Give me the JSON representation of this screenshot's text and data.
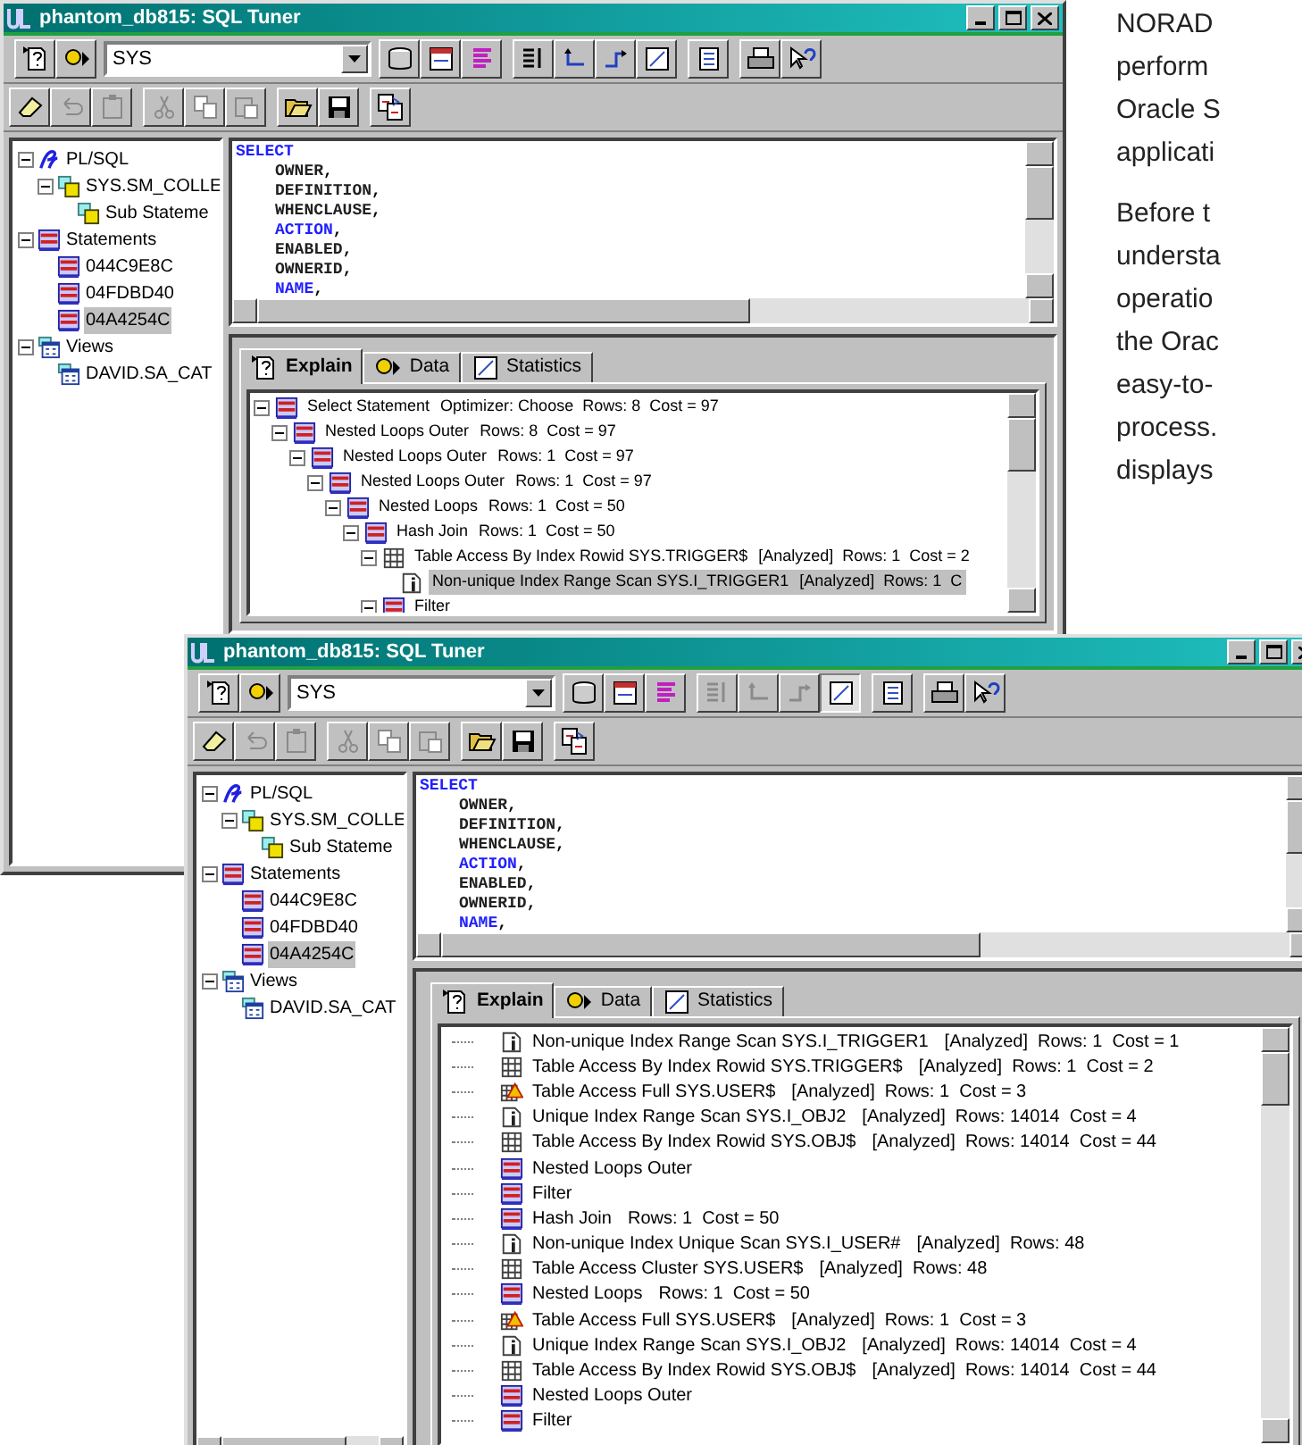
{
  "windows": [
    {
      "title": "phantom_db815: SQL Tuner",
      "schema": "SYS",
      "toolbar_top": [
        {
          "kind": "help-page",
          "disabled": false,
          "pressed": false
        },
        {
          "kind": "run",
          "disabled": false,
          "pressed": false
        },
        {
          "kind": "database",
          "disabled": false,
          "pressed": false
        },
        {
          "kind": "form",
          "disabled": false,
          "pressed": false
        },
        {
          "kind": "bars",
          "disabled": false,
          "pressed": false
        },
        {
          "kind": "split",
          "disabled": false,
          "pressed": false
        },
        {
          "kind": "step-in",
          "disabled": false,
          "pressed": false
        },
        {
          "kind": "step-out",
          "disabled": false,
          "pressed": false
        },
        {
          "kind": "chart",
          "disabled": false,
          "pressed": false
        },
        {
          "kind": "list",
          "disabled": false,
          "pressed": false
        },
        {
          "kind": "print",
          "disabled": false,
          "pressed": false
        },
        {
          "kind": "context-help",
          "disabled": false,
          "pressed": false
        }
      ],
      "toolbar_bottom": [
        {
          "kind": "eraser",
          "disabled": false,
          "pressed": false
        },
        {
          "kind": "undo",
          "disabled": true,
          "pressed": false
        },
        {
          "kind": "clipboard",
          "disabled": true,
          "pressed": false
        },
        {
          "kind": "cut",
          "disabled": true,
          "pressed": false
        },
        {
          "kind": "copy",
          "disabled": true,
          "pressed": false
        },
        {
          "kind": "paste",
          "disabled": true,
          "pressed": false
        },
        {
          "kind": "open",
          "disabled": false,
          "pressed": false
        },
        {
          "kind": "save",
          "disabled": false,
          "pressed": false
        },
        {
          "kind": "compare",
          "disabled": false,
          "pressed": false
        }
      ],
      "object_tree": [
        {
          "label": "PL/SQL",
          "kind": "plsql",
          "expanded": true,
          "selected": false,
          "children": [
            {
              "label": "SYS.SM_COLLE",
              "kind": "package",
              "expanded": true,
              "selected": false,
              "children": [
                {
                  "label": "Sub Stateme",
                  "kind": "package",
                  "selected": false
                }
              ]
            }
          ]
        },
        {
          "label": "Statements",
          "kind": "sql",
          "expanded": true,
          "selected": false,
          "children": [
            {
              "label": "044C9E8C",
              "kind": "sql",
              "selected": false
            },
            {
              "label": "04FDBD40",
              "kind": "sql",
              "selected": false
            },
            {
              "label": "04A4254C",
              "kind": "sql",
              "selected": true
            }
          ]
        },
        {
          "label": "Views",
          "kind": "view",
          "expanded": true,
          "selected": false,
          "children": [
            {
              "label": "DAVID.SA_CAT",
              "kind": "view",
              "selected": false
            }
          ]
        }
      ],
      "sql_lines": [
        {
          "text": "SELECT",
          "keyword": true
        },
        {
          "text": "OWNER",
          "keyword": false,
          "punct": ","
        },
        {
          "text": "DEFINITION",
          "keyword": false,
          "punct": ","
        },
        {
          "text": "WHENCLAUSE",
          "keyword": false,
          "punct": ","
        },
        {
          "text": "ACTION",
          "keyword": true,
          "punct": ","
        },
        {
          "text": "ENABLED",
          "keyword": false,
          "punct": ","
        },
        {
          "text": "OWNERID",
          "keyword": false,
          "punct": ","
        },
        {
          "text": "NAME",
          "keyword": true,
          "punct": ","
        }
      ],
      "tabs": [
        {
          "label": "Explain",
          "selected": true
        },
        {
          "label": "Data",
          "selected": false
        },
        {
          "label": "Statistics",
          "selected": false
        }
      ],
      "plan": [
        {
          "operation": "Select Statement",
          "details": "Optimizer: Choose  Rows: 8  Cost = 97",
          "kind": "sql",
          "expanded": true,
          "selected": false,
          "children": [
            {
              "operation": "Nested Loops Outer",
              "details": "Rows: 8  Cost = 97",
              "kind": "sql",
              "expanded": true,
              "selected": false,
              "children": [
                {
                  "operation": "Nested Loops Outer",
                  "details": "Rows: 1  Cost = 97",
                  "kind": "sql",
                  "expanded": true,
                  "selected": false,
                  "children": [
                    {
                      "operation": "Nested Loops Outer",
                      "details": "Rows: 1  Cost = 97",
                      "kind": "sql",
                      "expanded": true,
                      "selected": false,
                      "children": [
                        {
                          "operation": "Nested Loops",
                          "details": "Rows: 1  Cost = 50",
                          "kind": "sql",
                          "expanded": true,
                          "selected": false,
                          "children": [
                            {
                              "operation": "Hash Join",
                              "details": "Rows: 1  Cost = 50",
                              "kind": "sql",
                              "expanded": true,
                              "selected": false,
                              "children": [
                                {
                                  "operation": "Table Access By Index Rowid SYS.TRIGGER$",
                                  "details": "[Analyzed]  Rows: 1  Cost = 2",
                                  "kind": "table",
                                  "expanded": true,
                                  "selected": false,
                                  "children": [
                                    {
                                      "operation": "Non-unique Index Range Scan SYS.I_TRIGGER1",
                                      "details": "[Analyzed]  Rows: 1  C",
                                      "kind": "index",
                                      "selected": true
                                    }
                                  ]
                                },
                                {
                                  "operation": "Filter",
                                  "kind": "sql",
                                  "expanded": true,
                                  "selected": false
                                }
                              ]
                            }
                          ]
                        }
                      ]
                    }
                  ]
                }
              ]
            }
          ]
        }
      ]
    },
    {
      "title": "phantom_db815: SQL Tuner",
      "schema": "SYS",
      "toolbar_top": [
        {
          "kind": "help-page",
          "disabled": false,
          "pressed": false
        },
        {
          "kind": "run",
          "disabled": false,
          "pressed": false
        },
        {
          "kind": "database",
          "disabled": false,
          "pressed": false
        },
        {
          "kind": "form",
          "disabled": false,
          "pressed": false
        },
        {
          "kind": "bars",
          "disabled": false,
          "pressed": false
        },
        {
          "kind": "split",
          "disabled": true,
          "pressed": false
        },
        {
          "kind": "step-in",
          "disabled": true,
          "pressed": false
        },
        {
          "kind": "step-out",
          "disabled": true,
          "pressed": false
        },
        {
          "kind": "chart",
          "disabled": false,
          "pressed": true
        },
        {
          "kind": "list",
          "disabled": false,
          "pressed": false
        },
        {
          "kind": "print",
          "disabled": false,
          "pressed": false
        },
        {
          "kind": "context-help",
          "disabled": false,
          "pressed": false
        }
      ],
      "toolbar_bottom": [
        {
          "kind": "eraser",
          "disabled": false,
          "pressed": false
        },
        {
          "kind": "undo",
          "disabled": true,
          "pressed": false
        },
        {
          "kind": "clipboard",
          "disabled": true,
          "pressed": false
        },
        {
          "kind": "cut",
          "disabled": true,
          "pressed": false
        },
        {
          "kind": "copy",
          "disabled": true,
          "pressed": false
        },
        {
          "kind": "paste",
          "disabled": true,
          "pressed": false
        },
        {
          "kind": "open",
          "disabled": false,
          "pressed": false
        },
        {
          "kind": "save",
          "disabled": false,
          "pressed": false
        },
        {
          "kind": "compare",
          "disabled": false,
          "pressed": false
        }
      ],
      "object_tree": [
        {
          "label": "PL/SQL",
          "kind": "plsql",
          "expanded": true,
          "selected": false,
          "children": [
            {
              "label": "SYS.SM_COLLE",
              "kind": "package",
              "expanded": true,
              "selected": false,
              "children": [
                {
                  "label": "Sub Stateme",
                  "kind": "package",
                  "selected": false
                }
              ]
            }
          ]
        },
        {
          "label": "Statements",
          "kind": "sql",
          "expanded": true,
          "selected": false,
          "children": [
            {
              "label": "044C9E8C",
              "kind": "sql",
              "selected": false
            },
            {
              "label": "04FDBD40",
              "kind": "sql",
              "selected": false
            },
            {
              "label": "04A4254C",
              "kind": "sql",
              "selected": true
            }
          ]
        },
        {
          "label": "Views",
          "kind": "view",
          "expanded": true,
          "selected": false,
          "children": [
            {
              "label": "DAVID.SA_CAT",
              "kind": "view",
              "selected": false
            }
          ]
        }
      ],
      "sql_lines": [
        {
          "text": "SELECT",
          "keyword": true
        },
        {
          "text": "OWNER",
          "keyword": false,
          "punct": ","
        },
        {
          "text": "DEFINITION",
          "keyword": false,
          "punct": ","
        },
        {
          "text": "WHENCLAUSE",
          "keyword": false,
          "punct": ","
        },
        {
          "text": "ACTION",
          "keyword": true,
          "punct": ","
        },
        {
          "text": "ENABLED",
          "keyword": false,
          "punct": ","
        },
        {
          "text": "OWNERID",
          "keyword": false,
          "punct": ","
        },
        {
          "text": "NAME",
          "keyword": true,
          "punct": ","
        }
      ],
      "tabs": [
        {
          "label": "Explain",
          "selected": true
        },
        {
          "label": "Data",
          "selected": false
        },
        {
          "label": "Statistics",
          "selected": false
        }
      ],
      "plan": [
        {
          "operation": "Non-unique Index Range Scan SYS.I_TRIGGER1",
          "details": "[Analyzed]  Rows: 1  Cost = 1",
          "kind": "index",
          "selected": false
        },
        {
          "operation": "Table Access By Index Rowid SYS.TRIGGER$",
          "details": "[Analyzed]  Rows: 1  Cost = 2",
          "kind": "table",
          "selected": false
        },
        {
          "operation": "Table Access Full SYS.USER$",
          "details": "[Analyzed]  Rows: 1  Cost = 3",
          "kind": "warning",
          "selected": false
        },
        {
          "operation": "Unique Index Range Scan SYS.I_OBJ2",
          "details": "[Analyzed]  Rows: 14014  Cost = 4",
          "kind": "index",
          "selected": false
        },
        {
          "operation": "Table Access By Index Rowid SYS.OBJ$",
          "details": "[Analyzed]  Rows: 14014  Cost = 44",
          "kind": "table",
          "selected": false
        },
        {
          "operation": "Nested Loops Outer",
          "kind": "sql",
          "selected": false
        },
        {
          "operation": "Filter",
          "kind": "sql",
          "selected": false
        },
        {
          "operation": "Hash Join",
          "details": "Rows: 1  Cost = 50",
          "kind": "sql",
          "selected": false
        },
        {
          "operation": "Non-unique Index Unique Scan SYS.I_USER#",
          "details": "[Analyzed]  Rows: 48",
          "kind": "index",
          "selected": false
        },
        {
          "operation": "Table Access Cluster SYS.USER$",
          "details": "[Analyzed]  Rows: 48",
          "kind": "table",
          "selected": false
        },
        {
          "operation": "Nested Loops",
          "details": "Rows: 1  Cost = 50",
          "kind": "sql",
          "selected": false
        },
        {
          "operation": "Table Access Full SYS.USER$",
          "details": "[Analyzed]  Rows: 1  Cost = 3",
          "kind": "warning",
          "selected": false
        },
        {
          "operation": "Unique Index Range Scan SYS.I_OBJ2",
          "details": "[Analyzed]  Rows: 14014  Cost = 4",
          "kind": "index",
          "selected": false
        },
        {
          "operation": "Table Access By Index Rowid SYS.OBJ$",
          "details": "[Analyzed]  Rows: 14014  Cost = 44",
          "kind": "table",
          "selected": false
        },
        {
          "operation": "Nested Loops Outer",
          "kind": "sql",
          "selected": false
        },
        {
          "operation": "Filter",
          "kind": "sql",
          "selected": false
        }
      ]
    }
  ],
  "article_text": [
    {
      "lines": [
        "NORAD",
        "perform",
        "Oracle S",
        "applicati"
      ]
    },
    {
      "lines": [
        "Before t",
        "understa",
        "operatio",
        "the Orac",
        "easy-to-",
        "process.",
        "displays"
      ]
    }
  ]
}
